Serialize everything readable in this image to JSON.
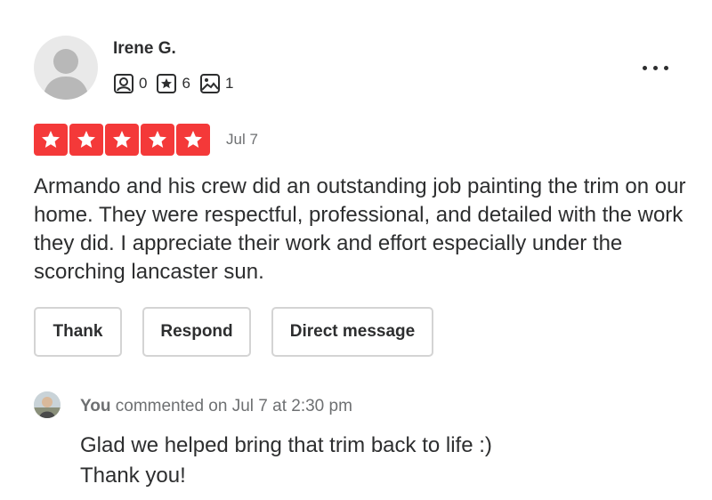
{
  "reviewer": {
    "name": "Irene G.",
    "stats": [
      {
        "icon": "friends-icon",
        "value": "0"
      },
      {
        "icon": "reviews-star-icon",
        "value": "6"
      },
      {
        "icon": "photos-icon",
        "value": "1"
      }
    ]
  },
  "rating": {
    "stars": 5,
    "max": 5,
    "color": "#f43939"
  },
  "review": {
    "date": "Jul 7",
    "text": "Armando and his crew did an outstanding job painting the trim on our home. They were respectful, professional, and detailed with the work they did. I appreciate their work and effort especially under the scorching lancaster sun."
  },
  "actions": {
    "thank": "Thank",
    "respond": "Respond",
    "direct_message": "Direct message"
  },
  "comment": {
    "author": "You",
    "meta": " commented on Jul 7 at 2:30 pm",
    "line1": "Glad we helped bring that trim back to life :)",
    "line2": "Thank you!"
  }
}
